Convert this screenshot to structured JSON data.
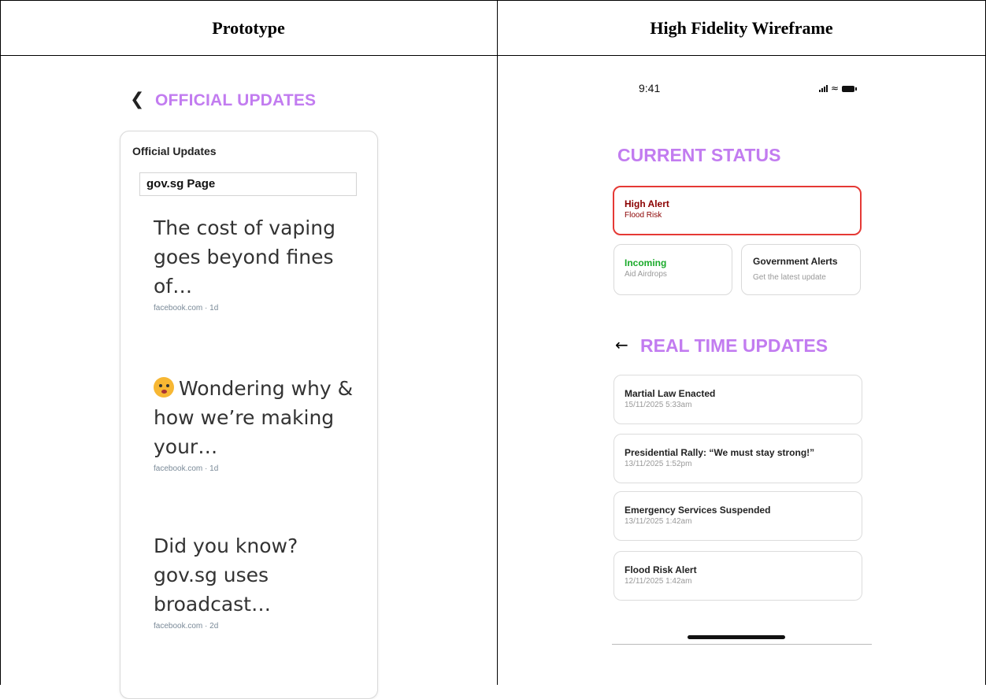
{
  "table": {
    "col1_header": "Prototype",
    "col2_header": "High Fidelity Wireframe"
  },
  "prototype": {
    "back_icon": "chevron-left-icon",
    "header_title": "OFFICIAL UPDATES",
    "card_title": "Official Updates",
    "page_label": "gov.sg Page",
    "posts": [
      {
        "text": "The cost of vaping goes beyond fines of…",
        "meta": "facebook.com · 1d"
      },
      {
        "text": "Wondering why & how we’re making your…",
        "meta": "facebook.com · 1d",
        "emoji": "thinking-face-icon"
      },
      {
        "text": "Did you know? gov.sg uses broadcast…",
        "meta": "facebook.com · 2d"
      }
    ]
  },
  "wireframe": {
    "time": "9:41",
    "status_icons": [
      "signal-icon",
      "wifi-icon",
      "battery-icon"
    ],
    "current_status_title": "CURRENT STATUS",
    "alert": {
      "title": "High Alert",
      "subtitle": "Flood Risk",
      "color": "#e53935",
      "text_color": "#8b0000"
    },
    "incoming": {
      "title": "Incoming",
      "subtitle": "Aid Airdrops",
      "color": "#1aaa2a"
    },
    "gov_alerts": {
      "title": "Government Alerts",
      "subtitle": "Get the latest update"
    },
    "back_icon": "arrow-left-icon",
    "realtime_title": "REAL TIME UPDATES",
    "updates": [
      {
        "title": "Martial Law Enacted",
        "date": "15/11/2025  5:33am"
      },
      {
        "title": "Presidential Rally: “We must stay strong!”",
        "date": "13/11/2025  1:52pm"
      },
      {
        "title": "Emergency Services Suspended",
        "date": "13/11/2025  1:42am"
      },
      {
        "title": "Flood Risk Alert",
        "date": "12/11/2025  1:42am"
      }
    ]
  },
  "colors": {
    "accent": "#c27cf0"
  }
}
